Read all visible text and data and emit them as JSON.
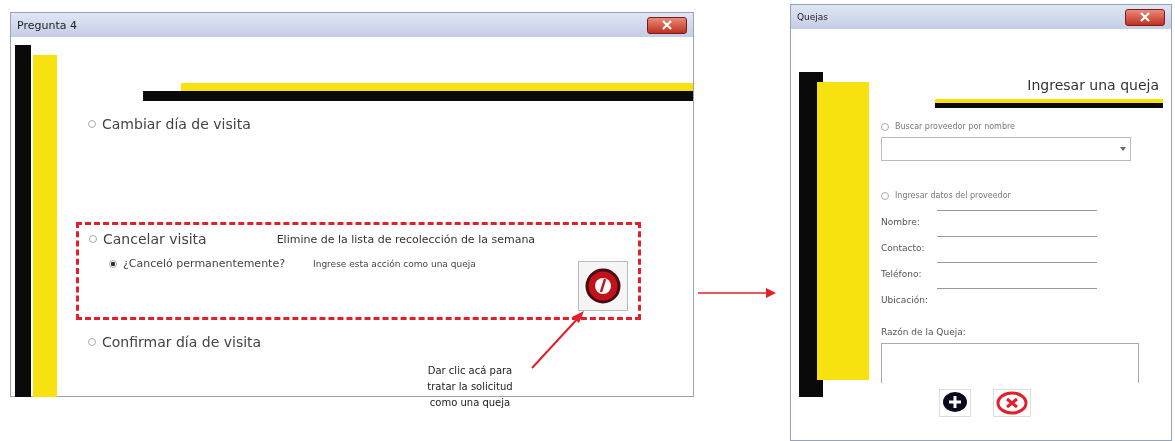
{
  "question_window": {
    "title": "Pregunta 4",
    "options": [
      {
        "label": "Cambiar día de visita",
        "selected": false,
        "highlighted": false
      },
      {
        "label": "Cancelar visita",
        "selected": false,
        "highlighted": true,
        "note": "Elimine de la lista de recolección de la semana",
        "sub_option": {
          "label": "¿Canceló permanentemente?",
          "selected": true,
          "hint": "Ingrese esta acción como una queja"
        }
      },
      {
        "label": "Confirmar día de visita",
        "selected": false,
        "highlighted": false
      }
    ]
  },
  "callout": [
    "Dar clic acá para",
    "tratar la solicitud",
    "como una queja"
  ],
  "complaint_window": {
    "title": "Quejas",
    "heading": "Ingresar una queja",
    "search_option": {
      "label": "Buscar proveedor por nombre",
      "selected": false
    },
    "manual_option": {
      "label": "Ingresar datos del proveedor",
      "selected": false
    },
    "fields": [
      {
        "label": "Nombre:"
      },
      {
        "label": "Contacto:"
      },
      {
        "label": "Teléfono:"
      },
      {
        "label": "Ubicación:"
      }
    ],
    "reason_label": "Razón de la Queja:"
  }
}
